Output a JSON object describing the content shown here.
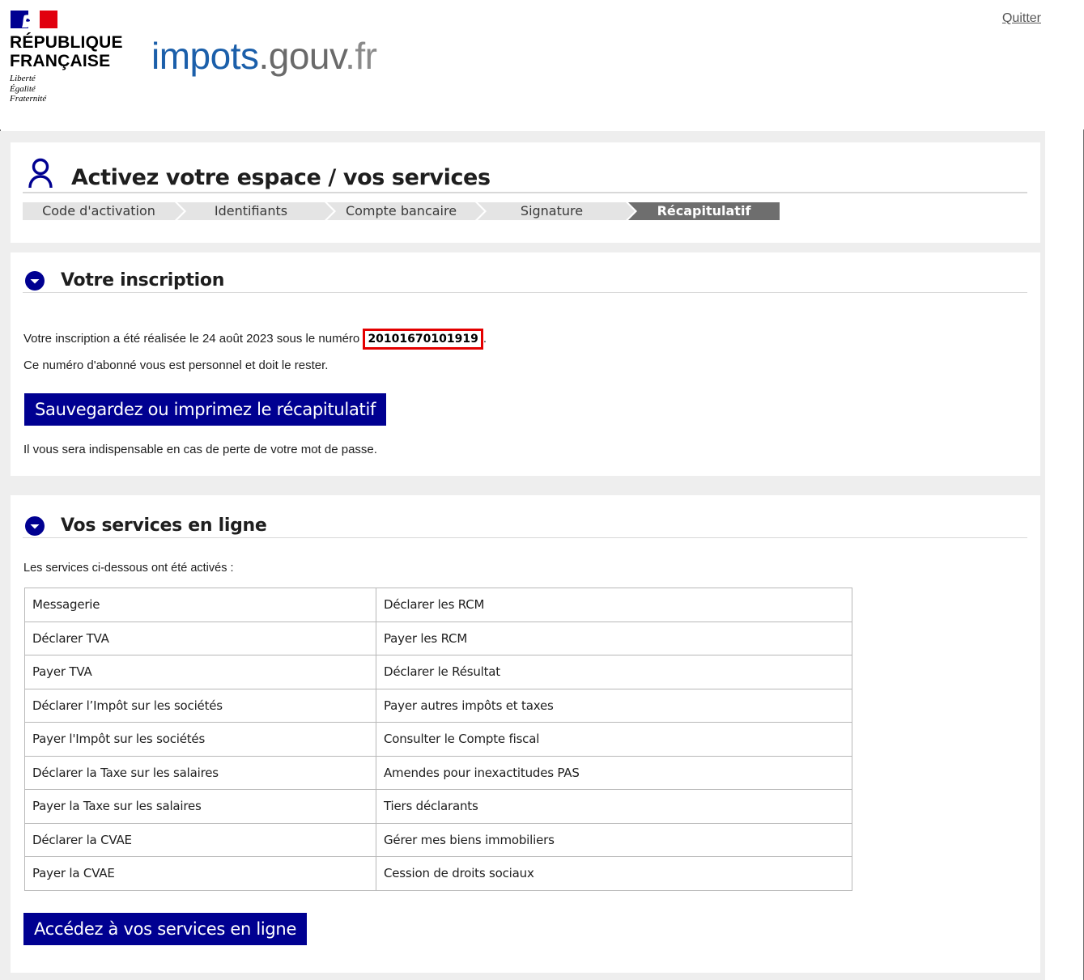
{
  "header": {
    "republic_line1": "RÉPUBLIQUE",
    "republic_line2": "FRANÇAISE",
    "motto_1": "Liberté",
    "motto_2": "Égalité",
    "motto_3": "Fraternité",
    "site_impots": "impots",
    "site_gouv": ".gouv",
    "site_fr": ".fr",
    "quit_label": "Quitter"
  },
  "activation": {
    "title": "Activez votre espace / vos services",
    "steps": [
      {
        "label": "Code d'activation",
        "active": false
      },
      {
        "label": "Identifiants",
        "active": false
      },
      {
        "label": "Compte bancaire",
        "active": false
      },
      {
        "label": "Signature",
        "active": false
      },
      {
        "label": "Récapitulatif",
        "active": true
      }
    ]
  },
  "inscription": {
    "title": "Votre inscription",
    "text_before": "Votre inscription a été réalisée le 24 août 2023 sous le numéro ",
    "subscriber_number": "20101670101919",
    "text_after": ".",
    "personal_note": "Ce numéro d'abonné vous est personnel et doit le rester.",
    "save_button": "Sauvegardez ou imprimez le récapitulatif",
    "warning": "Il vous sera indispensable en cas de perte de votre mot de passe."
  },
  "services": {
    "title": "Vos services en ligne",
    "intro": "Les services ci-dessous ont été activés :",
    "rows": [
      [
        "Messagerie",
        "Déclarer les RCM"
      ],
      [
        "Déclarer TVA",
        "Payer les RCM"
      ],
      [
        "Payer TVA",
        "Déclarer le Résultat"
      ],
      [
        "Déclarer l’Impôt sur les sociétés",
        "Payer autres impôts et taxes"
      ],
      [
        "Payer l'Impôt sur les sociétés",
        "Consulter le Compte fiscal"
      ],
      [
        "Déclarer la Taxe sur les salaires",
        "Amendes pour inexactitudes PAS"
      ],
      [
        "Payer la Taxe sur les salaires",
        "Tiers déclarants"
      ],
      [
        "Déclarer la CVAE",
        "Gérer mes biens immobiliers"
      ],
      [
        "Payer la CVAE",
        "Cession de droits sociaux"
      ]
    ],
    "access_button": "Accédez à vos services en ligne"
  },
  "colors": {
    "primary_button": "#000091",
    "highlight_border": "#e40000",
    "active_step": "#6e6e6e",
    "logo_blue": "#1b5faa"
  }
}
